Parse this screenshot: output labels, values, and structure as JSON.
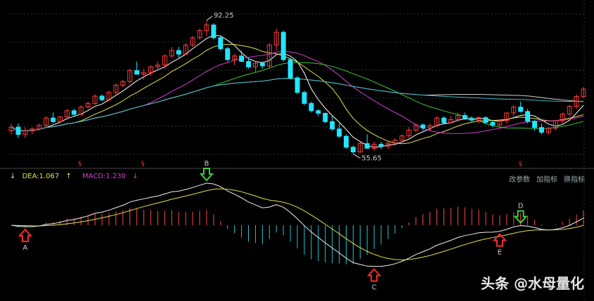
{
  "chart_data": [
    {
      "type": "candlestick",
      "annotations": {
        "high": "92.25",
        "low": "55.65"
      },
      "colors": {
        "up": "#ff3c3c",
        "down": "#22e5ff",
        "ma1": "#ffffff",
        "ma2": "#e8e04a",
        "ma3": "#d43bd4",
        "ma4": "#38c738",
        "ma5": "#cfcfcf",
        "ma6": "#3fb6c6"
      },
      "candles": [
        [
          62,
          64,
          61,
          63
        ],
        [
          63,
          64,
          60,
          61
        ],
        [
          61,
          63,
          60,
          62
        ],
        [
          62,
          63,
          61,
          62.5
        ],
        [
          62.5,
          64,
          62,
          63.5
        ],
        [
          63.5,
          66,
          63,
          65.5
        ],
        [
          65.5,
          67,
          64,
          64.5
        ],
        [
          64.5,
          66,
          64,
          65.8
        ],
        [
          65.8,
          68,
          65,
          67.5
        ],
        [
          67.5,
          68,
          66,
          66.5
        ],
        [
          66.5,
          69,
          66,
          68.5
        ],
        [
          68.5,
          70,
          68,
          69.5
        ],
        [
          69.5,
          72,
          69,
          71.5
        ],
        [
          71.5,
          72,
          70,
          70.5
        ],
        [
          70.5,
          73,
          70,
          72.5
        ],
        [
          72.5,
          75,
          72,
          74.5
        ],
        [
          74.5,
          76,
          74,
          75.5
        ],
        [
          75.5,
          79,
          75,
          78.5
        ],
        [
          78.5,
          81,
          78,
          77.5
        ],
        [
          77.5,
          79,
          76,
          78
        ],
        [
          78,
          80,
          77,
          79.5
        ],
        [
          79.5,
          81,
          79,
          80
        ],
        [
          80,
          83,
          79,
          82.5
        ],
        [
          82.5,
          85,
          82,
          84
        ],
        [
          84,
          85,
          82,
          83
        ],
        [
          83,
          86,
          83,
          85.5
        ],
        [
          85.5,
          88,
          85,
          87.5
        ],
        [
          87.5,
          90,
          87,
          89.5
        ],
        [
          89.5,
          92.25,
          88,
          91
        ],
        [
          91,
          91.5,
          87,
          87.5
        ],
        [
          87.5,
          88,
          84,
          84.5
        ],
        [
          84.5,
          85,
          81,
          81.5
        ],
        [
          81.5,
          83,
          80,
          82.5
        ],
        [
          82.5,
          84,
          81,
          81
        ],
        [
          81,
          82,
          79,
          79.5
        ],
        [
          79.5,
          81,
          78,
          80.5
        ],
        [
          80.5,
          81,
          79,
          79.8
        ],
        [
          79.8,
          86,
          79,
          85.5
        ],
        [
          85.5,
          90,
          84,
          89
        ],
        [
          89,
          89.5,
          81,
          81.5
        ],
        [
          81.5,
          82,
          76,
          76.5
        ],
        [
          76.5,
          77,
          72,
          72.5
        ],
        [
          72.5,
          73,
          69,
          69.5
        ],
        [
          69.5,
          70,
          67,
          67.5
        ],
        [
          67.5,
          68,
          66,
          66.8
        ],
        [
          66.8,
          67,
          64,
          64.5
        ],
        [
          64.5,
          66,
          62,
          62.5
        ],
        [
          62.5,
          64,
          60,
          60.5
        ],
        [
          60.5,
          61,
          57,
          57.5
        ],
        [
          57.5,
          58,
          55.65,
          56.2
        ],
        [
          56.2,
          59,
          56,
          58.5
        ],
        [
          58.5,
          61,
          58,
          57.2
        ],
        [
          57.2,
          59,
          56.5,
          58.3
        ],
        [
          58.3,
          59,
          57,
          57.8
        ],
        [
          57.8,
          59,
          57,
          58.6
        ],
        [
          58.6,
          60,
          58,
          59.4
        ],
        [
          59.4,
          61,
          59,
          60.6
        ],
        [
          60.6,
          63,
          60,
          62.2
        ],
        [
          62.2,
          64,
          61.5,
          63.6
        ],
        [
          63.6,
          64,
          62,
          62.8
        ],
        [
          62.8,
          64,
          62,
          63.4
        ],
        [
          63.4,
          66,
          63,
          65.5
        ],
        [
          65.5,
          66,
          64,
          64.2
        ],
        [
          64.2,
          66,
          64,
          65.1
        ],
        [
          65.1,
          67,
          64.5,
          66.2
        ],
        [
          66.2,
          67,
          65,
          65.4
        ],
        [
          65.4,
          66,
          64.5,
          64.9
        ],
        [
          64.9,
          66,
          64,
          65.6
        ],
        [
          65.6,
          66,
          64,
          64.3
        ],
        [
          64.3,
          65,
          63,
          63.6
        ],
        [
          63.6,
          65,
          63,
          64.8
        ],
        [
          64.8,
          67,
          64,
          66.9
        ],
        [
          66.9,
          69,
          66,
          68.5
        ],
        [
          68.5,
          70,
          67,
          67.3
        ],
        [
          67.3,
          68,
          64,
          64.6
        ],
        [
          64.6,
          65,
          62,
          62.9
        ],
        [
          62.9,
          64,
          61,
          61.6
        ],
        [
          61.6,
          63,
          61,
          62.7
        ],
        [
          62.7,
          65,
          62,
          64.8
        ],
        [
          64.8,
          67,
          64,
          66.6
        ],
        [
          66.6,
          69,
          66,
          68.7
        ],
        [
          68.7,
          72,
          68,
          71.4
        ],
        [
          71.4,
          74,
          71,
          73.4
        ]
      ],
      "signals": [
        "§",
        "§",
        "§"
      ]
    },
    {
      "type": "macd",
      "legend": [
        {
          "text": "↓"
        },
        {
          "text": "DEA:1.067",
          "arrow": "↑"
        },
        {
          "text": "MACD:1.230",
          "arrow": "↓"
        }
      ],
      "markers": [
        {
          "label": "A",
          "type": "up"
        },
        {
          "label": "B",
          "type": "down"
        },
        {
          "label": "C",
          "type": "up"
        },
        {
          "label": "D",
          "type": "down"
        },
        {
          "label": "E",
          "type": "up"
        }
      ],
      "buttons": [
        "改参数",
        "加指标",
        "换指标"
      ]
    }
  ],
  "watermark": {
    "text": "头条 @水母量化"
  }
}
